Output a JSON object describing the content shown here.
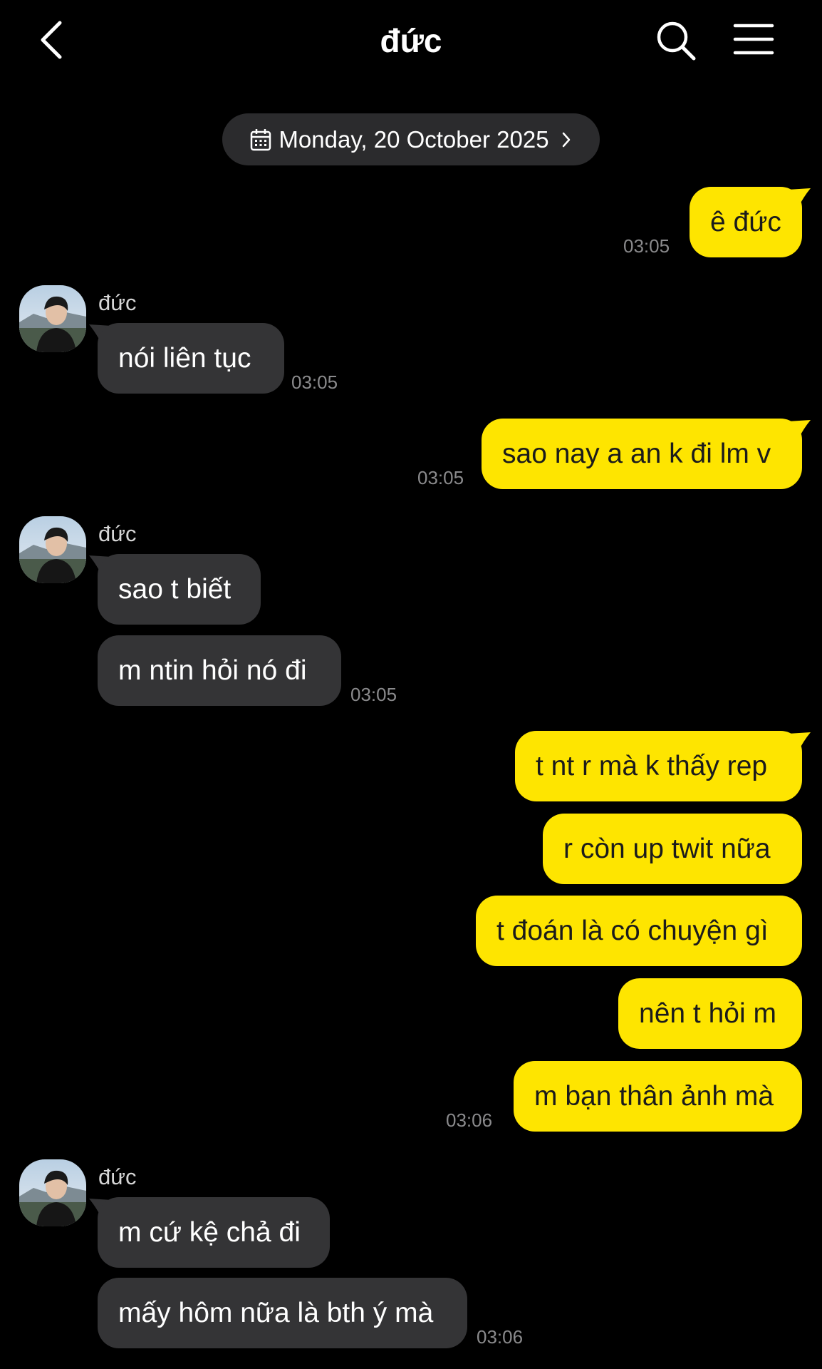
{
  "header": {
    "title": "đức",
    "icons": {
      "back": "chevron-left-icon",
      "search": "search-icon",
      "menu": "hamburger-menu-icon"
    }
  },
  "date_divider": {
    "label": "Monday, 20 October 2025",
    "icon": "calendar-icon"
  },
  "colors": {
    "outgoing": "#fee500",
    "incoming": "#343436",
    "background": "#000000",
    "time": "#8a8a8c"
  },
  "messages": [
    {
      "dir": "out",
      "text": "ê đức",
      "time": "03:05"
    },
    {
      "dir": "in",
      "sender": "đức",
      "text": "nói liên tục",
      "time": "03:05"
    },
    {
      "dir": "out",
      "text": "sao nay a an k đi lm v",
      "time": "03:05"
    },
    {
      "dir": "in",
      "sender": "đức",
      "text": "sao t biết"
    },
    {
      "dir": "in",
      "text": "m ntin hỏi nó đi",
      "time": "03:05"
    },
    {
      "dir": "out",
      "text": "t nt r mà k thấy rep"
    },
    {
      "dir": "out",
      "text": "r còn up twit nữa"
    },
    {
      "dir": "out",
      "text": "t đoán là có chuyện gì"
    },
    {
      "dir": "out",
      "text": "nên t hỏi m"
    },
    {
      "dir": "out",
      "text": "m bạn thân ảnh mà",
      "time": "03:06"
    },
    {
      "dir": "in",
      "sender": "đức",
      "text": "m cứ kệ chả đi"
    },
    {
      "dir": "in",
      "text": "mấy hôm nữa là bth ý mà",
      "time": "03:06"
    }
  ]
}
